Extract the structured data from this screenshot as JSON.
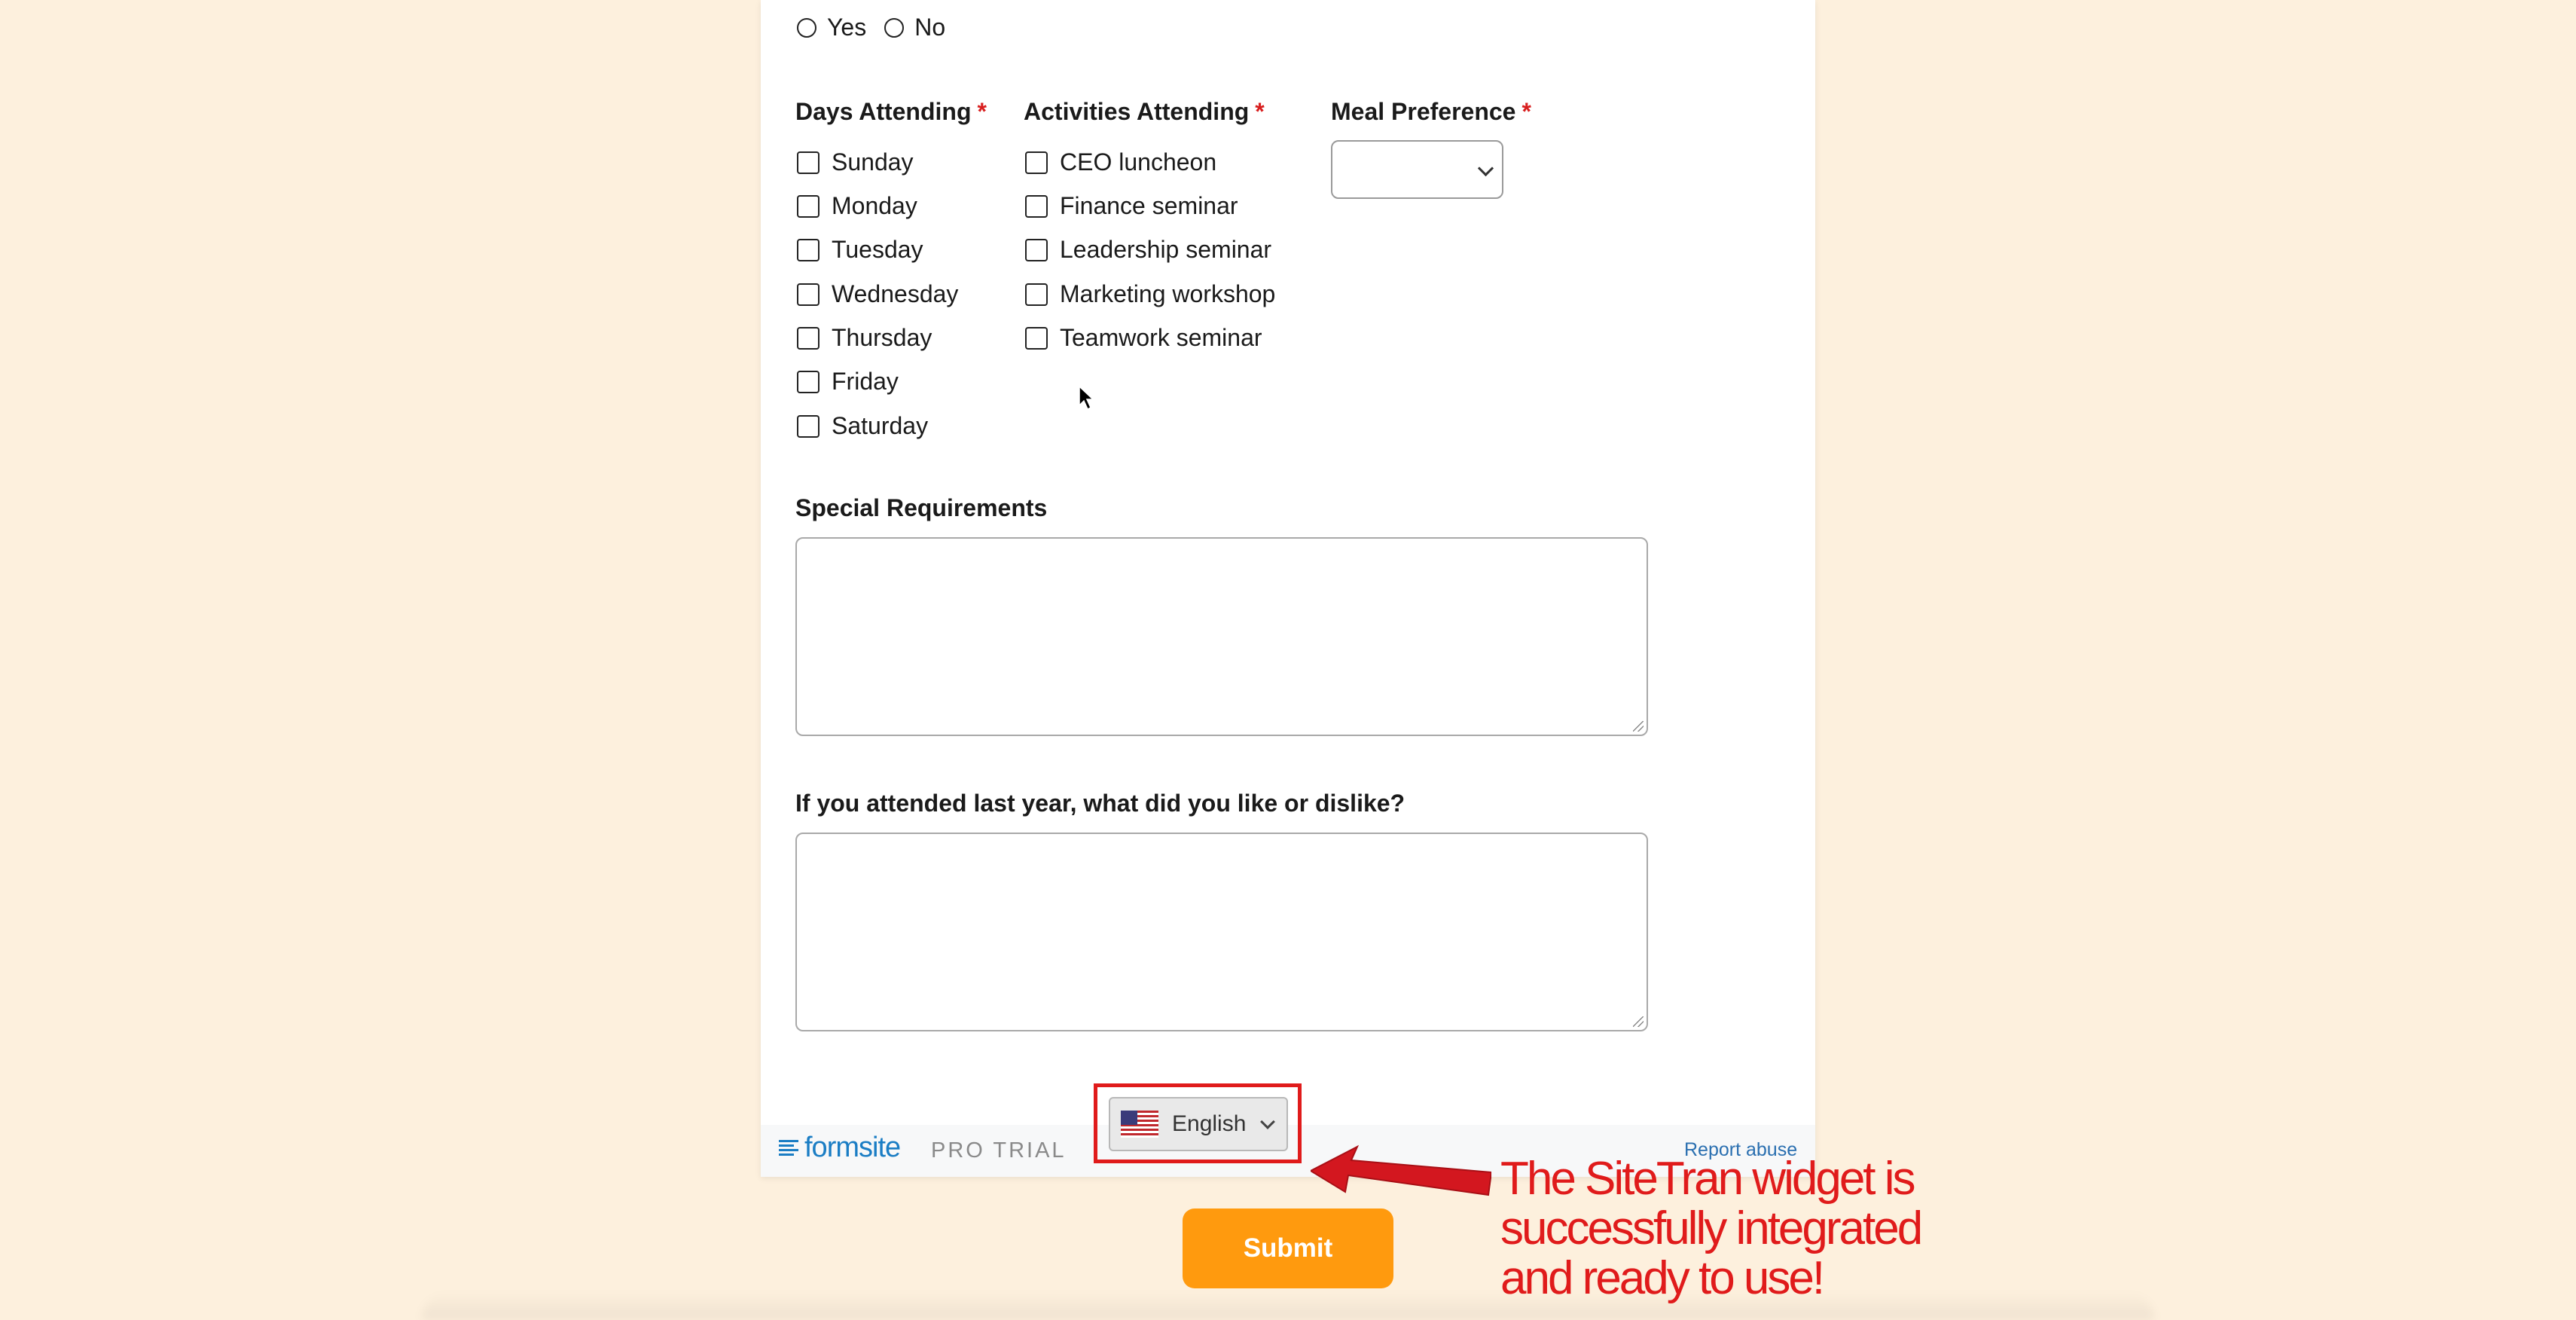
{
  "attendance_question": {
    "options": [
      "Yes",
      "No"
    ]
  },
  "days": {
    "label": "Days Attending",
    "required_mark": "*",
    "items": [
      "Sunday",
      "Monday",
      "Tuesday",
      "Wednesday",
      "Thursday",
      "Friday",
      "Saturday"
    ]
  },
  "activities": {
    "label": "Activities Attending",
    "required_mark": "*",
    "items": [
      "CEO luncheon",
      "Finance seminar",
      "Leadership seminar",
      "Marketing workshop",
      "Teamwork seminar"
    ]
  },
  "meal": {
    "label": "Meal Preference",
    "required_mark": "*",
    "selected": ""
  },
  "special_requirements": {
    "label": "Special Requirements",
    "value": ""
  },
  "feedback": {
    "label": "If you attended last year, what did you like or dislike?",
    "value": ""
  },
  "footer": {
    "brand": "formsite",
    "plan": "PRO TRIAL",
    "report_link": "Report abuse"
  },
  "language_widget": {
    "selected": "English",
    "flag_icon": "us-flag-icon"
  },
  "submit": {
    "label": "Submit"
  },
  "annotation": {
    "text": "The SiteTran widget is successfully integrated and ready to use!"
  },
  "colors": {
    "background": "#fdf0dd",
    "required": "#d81e1e",
    "submit": "#ff9a0e",
    "brand": "#1a7dc4",
    "annotation": "#e01b1b"
  }
}
